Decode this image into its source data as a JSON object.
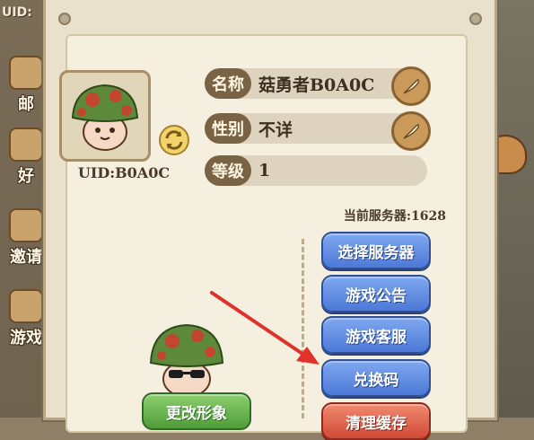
{
  "background": {
    "uid_fragment": "UID:",
    "side_buttons": [
      {
        "label": "邮",
        "icon": "mail-icon"
      },
      {
        "label": "好",
        "icon": "friends-icon"
      },
      {
        "label": "邀请",
        "icon": "invite-icon"
      },
      {
        "label": "游戏",
        "icon": "game-icon"
      }
    ]
  },
  "profile": {
    "uid": "UID:B0A0C",
    "fields": [
      {
        "key": "名称",
        "value": "菇勇者B0A0C",
        "editable": true
      },
      {
        "key": "性别",
        "value": "不详",
        "editable": true
      },
      {
        "key": "等级",
        "value": "1",
        "editable": false
      }
    ]
  },
  "server": {
    "current_label": "当前服务器:1628"
  },
  "menu": {
    "buttons": [
      {
        "label": "选择服务器",
        "color": "#4c79d6"
      },
      {
        "label": "游戏公告",
        "color": "#4c79d6"
      },
      {
        "label": "游戏客服",
        "color": "#4c79d6"
      },
      {
        "label": "兑换码",
        "color": "#4c79d6"
      },
      {
        "label": "清理缓存",
        "color": "#d24a36"
      }
    ]
  },
  "change_appearance_label": "更改形象",
  "annotation": {
    "color": "#e0322a",
    "icon": "red-arrow-icon"
  }
}
